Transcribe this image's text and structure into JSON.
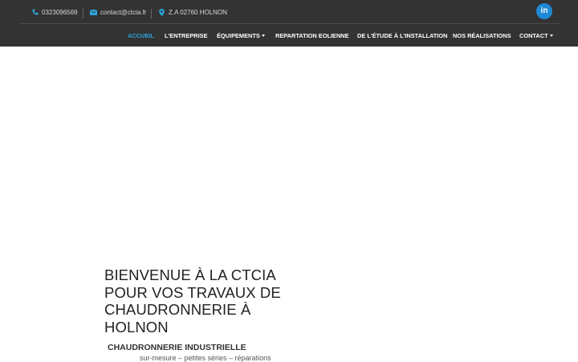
{
  "topbar": {
    "phone": "0323096569",
    "email": "contact@ctcia.fr",
    "address": "Z.A 02760 HOLNON",
    "phone_icon": "phone-icon",
    "email_icon": "envelope-icon",
    "address_icon": "map-marker-icon",
    "social_icon": "linkedin-icon",
    "social_label": "in"
  },
  "nav": {
    "items": [
      {
        "label": "ACCUEIL",
        "active": true
      },
      {
        "label": "L'ENTREPRISE"
      },
      {
        "label": "ÉQUIPEMENTS",
        "dropdown": true
      },
      {
        "label": "REPARTATION EOLIENNE"
      },
      {
        "label": "DE L'ÉTUDE À L'INSTALLATION"
      },
      {
        "label": "NOS RÉALISATIONS"
      },
      {
        "label": "CONTACT",
        "dropdown": true
      }
    ]
  },
  "hero": {
    "title": "BIENVENUE À LA CTCIA\nPOUR VOS TRAVAUX DE\nCHAUDRONNERIE À\nHOLNON",
    "subtitle": "CHAUDRONNERIE INDUSTRIELLE",
    "tagline": "sur-mesure – petites séries – réparations"
  },
  "colors": {
    "header_bg": "#333333",
    "accent": "#2aa6df",
    "linkedin": "#1e88d4"
  }
}
